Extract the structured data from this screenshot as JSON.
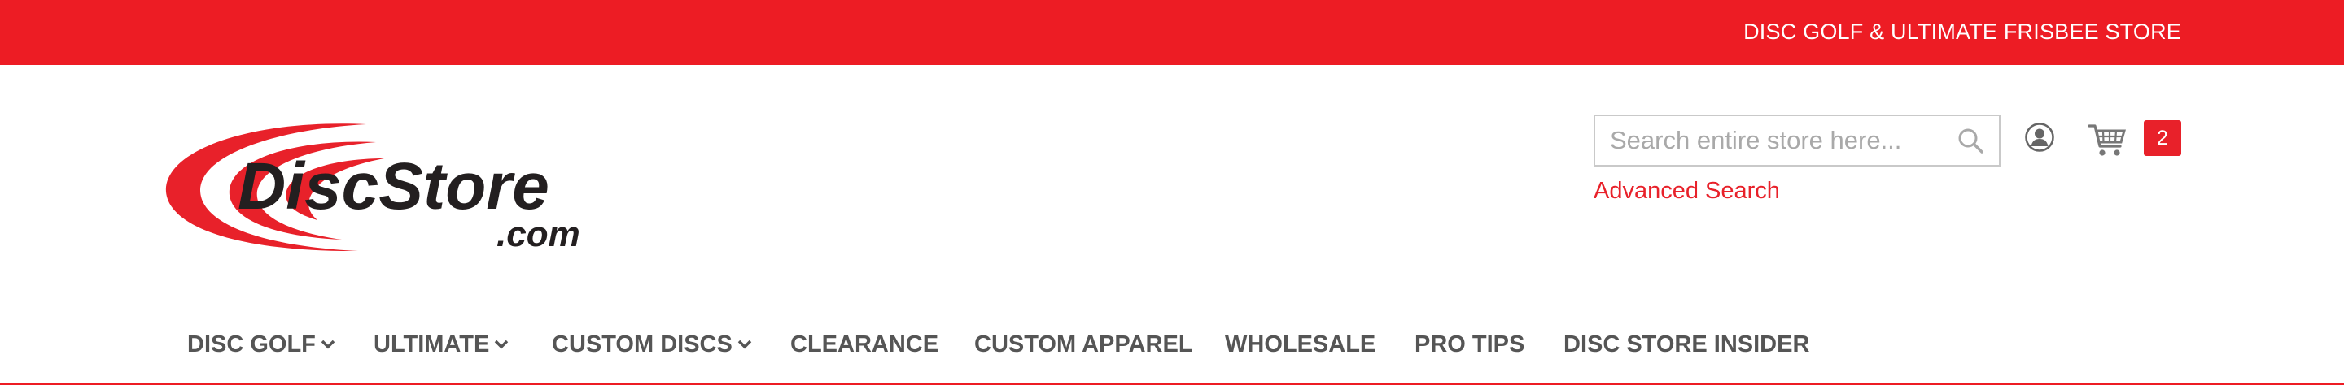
{
  "top_bar": {
    "tagline": "DISC GOLF & ULTIMATE FRISBEE STORE",
    "background": "#ed1c24"
  },
  "logo": {
    "text_main": "DiscStore",
    "text_sub": ".com",
    "accent": "#e8212a",
    "text_color": "#231f20"
  },
  "search": {
    "placeholder": "Search entire store here...",
    "value": "",
    "icon": "search-icon",
    "advanced_label": "Advanced Search"
  },
  "account": {
    "icon": "user-account-icon"
  },
  "cart": {
    "icon": "shopping-cart-icon",
    "count": "2",
    "badge_color": "#e8212a"
  },
  "nav": {
    "items": [
      {
        "label": "DISC GOLF",
        "dropdown": true
      },
      {
        "label": "ULTIMATE",
        "dropdown": true
      },
      {
        "label": "CUSTOM DISCS",
        "dropdown": true
      },
      {
        "label": "CLEARANCE",
        "dropdown": false
      },
      {
        "label": "CUSTOM APPAREL",
        "dropdown": false
      },
      {
        "label": "WHOLESALE",
        "dropdown": false
      },
      {
        "label": "PRO TIPS",
        "dropdown": false
      },
      {
        "label": "DISC STORE INSIDER",
        "dropdown": false
      }
    ],
    "text_color": "#555555"
  }
}
